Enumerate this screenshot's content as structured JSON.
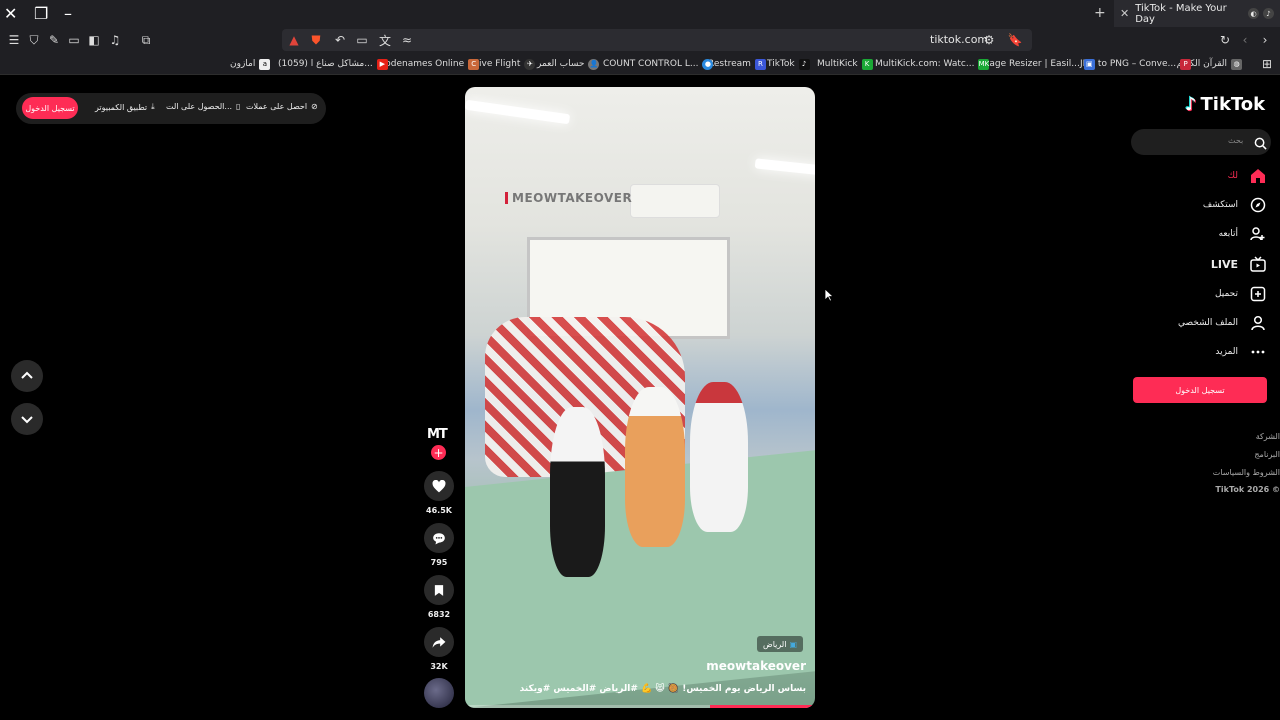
{
  "browser": {
    "tab_title": "TikTok - Make Your Day",
    "url": "tiktok.com",
    "bookmarks": [
      {
        "label": "القرآن الكريم",
        "icon": "globe-icon"
      },
      {
        "label": "JPG to PNG – Conve...",
        "icon": "png-icon"
      },
      {
        "label": "Image Resizer | Easil...",
        "icon": "image-icon"
      },
      {
        "label": "MultiKick.com: Watc...",
        "icon": "mk-icon"
      },
      {
        "label": "MultiKick",
        "icon": "k-icon"
      },
      {
        "label": "TikTok",
        "icon": "tiktok-icon"
      },
      {
        "label": "Restream",
        "icon": "r-icon"
      },
      {
        "label": "COUNT CONTROL L...",
        "icon": "circle-icon"
      },
      {
        "label": "حساب العمر",
        "icon": "user-icon"
      },
      {
        "label": "Live Flight",
        "icon": "flight-icon"
      },
      {
        "label": "Codenames Online",
        "icon": "codenames-icon"
      },
      {
        "label": "(1059) مشاكل صناع ا...",
        "icon": "youtube-icon"
      },
      {
        "label": "امازون",
        "icon": "amazon-icon"
      }
    ]
  },
  "topbar": {
    "login": "تسجيل الدخول",
    "desktop_app": "تطبيق الكمبيوتر",
    "get_app": "الحصول على الت...",
    "get_coins": "احصل على عملات"
  },
  "video": {
    "watermark": "MEOWTAKEOVER",
    "location": "الرياض",
    "author": "meowtakeover",
    "caption": "بساس الرياض يوم الخميس! 🥘 😸 💪 #الرياض #الخميس #ويكند",
    "progress_percent": 30
  },
  "actions": {
    "creator_badge": "MT",
    "likes": "46.5K",
    "comments": "795",
    "saves": "6832",
    "shares": "32K"
  },
  "sidebar": {
    "logo": "TikTok",
    "search_placeholder": "بحث",
    "items": [
      {
        "label": "لك",
        "icon": "home-icon",
        "active": true
      },
      {
        "label": "استكشف",
        "icon": "compass-icon"
      },
      {
        "label": "أتابعه",
        "icon": "following-icon"
      },
      {
        "label": "LIVE",
        "icon": "live-icon"
      },
      {
        "label": "تحميل",
        "icon": "upload-icon"
      },
      {
        "label": "الملف الشخصي",
        "icon": "profile-icon"
      },
      {
        "label": "المزيد",
        "icon": "more-icon"
      }
    ],
    "login_button": "تسجيل الدخول",
    "footer": [
      "الشركة",
      "البرنامج",
      "الشروط والسياسات"
    ],
    "copyright": "TikTok 2026 ©"
  },
  "colors": {
    "accent": "#fe2c55",
    "background": "#000000"
  }
}
